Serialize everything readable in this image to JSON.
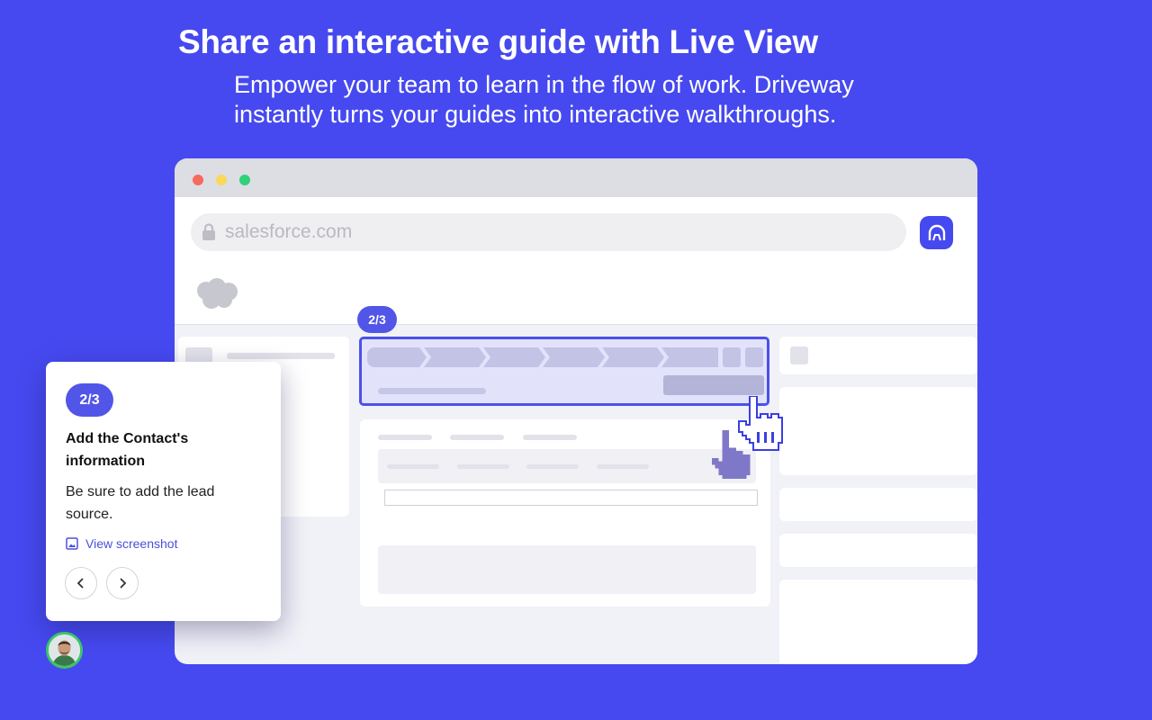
{
  "hero": {
    "title": "Share an interactive guide with Live View",
    "subtitle_line1": "Empower your team to learn in the flow of work. Driveway",
    "subtitle_line2": "instantly turns your guides into interactive walkthroughs."
  },
  "browser": {
    "url": "salesforce.com",
    "icons": {
      "lock": "lock-icon",
      "extension": "driveway-extension-icon",
      "logo": "salesforce-cloud-icon"
    }
  },
  "highlight": {
    "step_badge": "2/3"
  },
  "tooltip": {
    "step_badge": "2/3",
    "title": "Add the Contact's information",
    "body": "Be sure to add the lead source.",
    "link_label": "View screenshot",
    "prev_icon": "chevron-left-icon",
    "next_icon": "chevron-right-icon"
  },
  "colors": {
    "background": "#4649ef",
    "accent": "#5156e8",
    "highlight_fill": "#e2e2fb"
  }
}
